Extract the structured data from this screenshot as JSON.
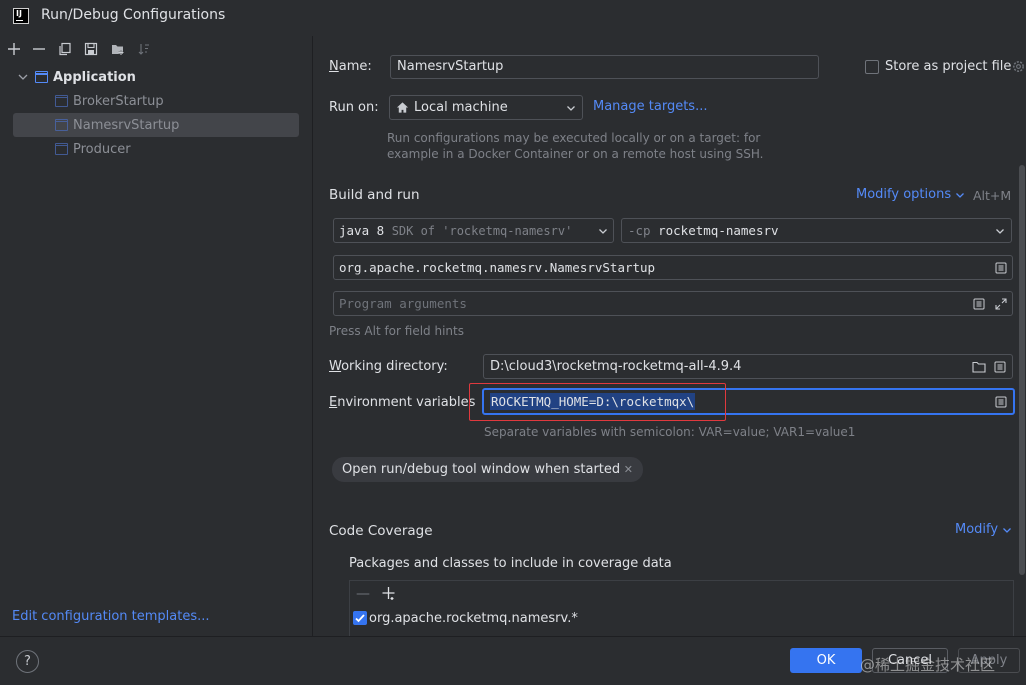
{
  "window": {
    "title": "Run/Debug Configurations",
    "logo_text": "IJ"
  },
  "toolbar": {
    "icons": [
      "add-icon",
      "remove-icon",
      "copy-icon",
      "save-icon",
      "new-folder-icon",
      "sort-icon"
    ]
  },
  "tree": {
    "root_label": "Application",
    "items": [
      {
        "label": "BrokerStartup",
        "selected": false
      },
      {
        "label": "NamesrvStartup",
        "selected": true
      },
      {
        "label": "Producer",
        "selected": false
      }
    ]
  },
  "left_footer": {
    "edit_templates_label": "Edit configuration templates..."
  },
  "form": {
    "name_label": "Name:",
    "name_value": "NamesrvStartup",
    "store_as_project_label": "Store as project file",
    "store_as_project_checked": false,
    "run_on_label": "Run on:",
    "run_on_value": "Local machine",
    "manage_targets_label": "Manage targets...",
    "run_on_hint_line1": "Run configurations may be executed locally or on a target: for",
    "run_on_hint_line2": "example in a Docker Container or on a remote host using SSH.",
    "build_run_title": "Build and run",
    "modify_options_label": "Modify options",
    "modify_options_shortcut": "Alt+M",
    "sdk_main": "java 8",
    "sdk_hint": "SDK of 'rocketmq-namesrv'",
    "cp_prefix": "-cp",
    "cp_value": "rocketmq-namesrv",
    "main_class_value": "org.apache.rocketmq.namesrv.NamesrvStartup",
    "program_args_placeholder": "Program arguments",
    "field_hints_text": "Press Alt for field hints",
    "working_dir_label": "Working directory:",
    "working_dir_value": "D:\\cloud3\\rocketmq-rocketmq-all-4.9.4",
    "env_vars_label": "Environment variables",
    "env_vars_value": "ROCKETMQ_HOME=D:\\rocketmqx\\",
    "env_vars_hint": "Separate variables with semicolon: VAR=value; VAR1=value1",
    "tag_label": "Open run/debug tool window when started",
    "code_coverage_title": "Code Coverage",
    "modify_label": "Modify",
    "coverage_subtitle": "Packages and classes to include in coverage data",
    "coverage_items": [
      {
        "label": "org.apache.rocketmq.namesrv.*",
        "checked": true
      }
    ]
  },
  "footer": {
    "help_label": "?",
    "ok_label": "OK",
    "cancel_label": "Cancel",
    "apply_label": "Apply",
    "watermark": "@稀土掘金技术社区"
  },
  "colors": {
    "background": "#2b2d30",
    "accent": "#548af7",
    "primary_button": "#3574f0",
    "highlight_box": "#e0393e",
    "focus_border": "#3574f0"
  }
}
